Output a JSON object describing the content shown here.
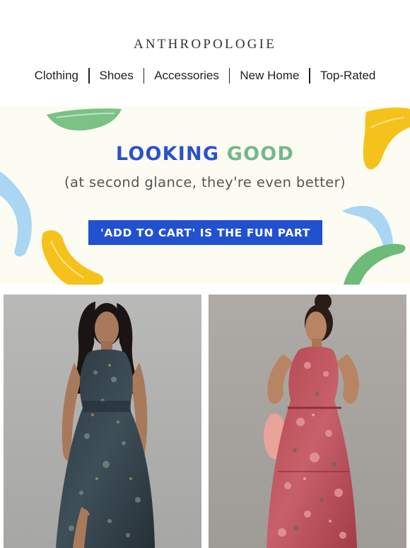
{
  "brand": {
    "logo": "ANTHROPOLOGIE"
  },
  "nav": {
    "items": [
      {
        "label": "Clothing"
      },
      {
        "label": "Shoes"
      },
      {
        "label": "Accessories"
      },
      {
        "label": "New Home"
      },
      {
        "label": "Top-Rated"
      }
    ]
  },
  "banner": {
    "headline_word1": "LOOKING",
    "headline_word2": "GOOD",
    "subline": "(at second glance, they're even better)",
    "cta_label": "'ADD TO CART' IS THE FUN PART",
    "colors": {
      "blue": "#2a52c9",
      "green": "#71b98a",
      "yellow": "#f5c518",
      "lightblue": "#a9d8f5",
      "background": "#fdfcf3"
    }
  },
  "products": [
    {
      "image": "woman-in-dark-floral-halter-maxi-dress-photo"
    },
    {
      "image": "woman-in-pink-floral-halter-maxi-dress-photo"
    }
  ]
}
